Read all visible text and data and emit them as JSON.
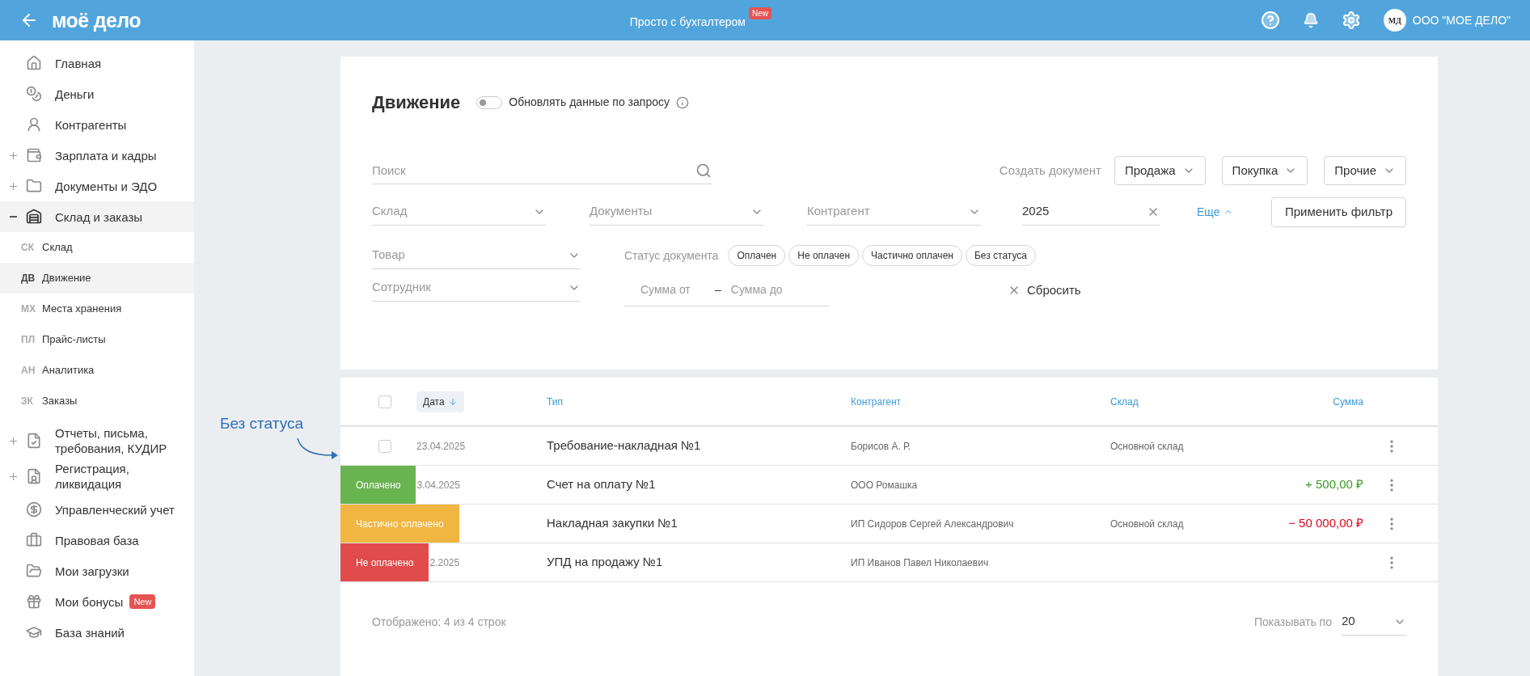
{
  "header": {
    "logo": "моё дело",
    "promo": "Просто с бухгалтером",
    "promo_badge": "New",
    "avatar": "МД",
    "company": "ООО \"МОЕ ДЕЛО\""
  },
  "sidebar": {
    "items": [
      {
        "label": "Главная",
        "selected": false
      },
      {
        "label": "Деньги",
        "selected": false
      },
      {
        "label": "Контрагенты",
        "selected": false
      },
      {
        "label": "Зарплата и кадры",
        "selected": false,
        "expanded": false
      },
      {
        "label": "Документы и ЭДО",
        "selected": false,
        "expanded": false
      },
      {
        "label": "Склад и заказы",
        "selected": true,
        "expanded": true,
        "children": [
          {
            "abbr": "СК",
            "label": "Склад",
            "selected": false
          },
          {
            "abbr": "ДВ",
            "label": "Движение",
            "selected": true
          },
          {
            "abbr": "МХ",
            "label": "Места хранения",
            "selected": false
          },
          {
            "abbr": "ПЛ",
            "label": "Прайс-листы",
            "selected": false
          },
          {
            "abbr": "АН",
            "label": "Аналитика",
            "selected": false
          },
          {
            "abbr": "ЗК",
            "label": "Заказы",
            "selected": false
          }
        ]
      },
      {
        "label": "Отчеты, письма, требования, КУДИР",
        "selected": false,
        "expanded": false
      },
      {
        "label": "Регистрация, ликвидация",
        "selected": false,
        "expanded": false
      },
      {
        "label": "Управленческий учет",
        "selected": false
      },
      {
        "label": "Правовая база",
        "selected": false
      },
      {
        "label": "Мои загрузки",
        "selected": false
      },
      {
        "label": "Мои бонусы",
        "selected": false,
        "badge": "New"
      },
      {
        "label": "База знаний",
        "selected": false
      }
    ]
  },
  "filters": {
    "title": "Движение",
    "auto_update": {
      "label": "Обновлять данные по запросу",
      "on": false
    },
    "search": {
      "placeholder": "Поиск"
    },
    "create_label": "Создать документ",
    "create_buttons": [
      "Продажа",
      "Покупка",
      "Прочие"
    ],
    "selects_row": [
      {
        "placeholder": "Склад"
      },
      {
        "placeholder": "Документы"
      },
      {
        "placeholder": "Контрагент"
      }
    ],
    "year": {
      "value": "2025"
    },
    "more": {
      "label": "Еще",
      "expanded": true
    },
    "apply": "Применить фильтр",
    "product": {
      "placeholder": "Товар"
    },
    "employee": {
      "placeholder": "Сотрудник"
    },
    "status_label": "Статус документа",
    "status_chips": [
      {
        "label": "Оплачен",
        "selected": false
      },
      {
        "label": "Не оплачен",
        "selected": false
      },
      {
        "label": "Частично оплачен",
        "selected": false
      },
      {
        "label": "Без статуса",
        "selected": false
      }
    ],
    "sum_from": {
      "placeholder": "Сумма от"
    },
    "sum_dash": "–",
    "sum_to": {
      "placeholder": "Сумма до"
    },
    "reset": "Сбросить"
  },
  "annotation": "Без статуса",
  "table": {
    "select_all": {
      "checked": false
    },
    "columns": [
      "Дата",
      "Тип",
      "Контрагент",
      "Склад",
      "Сумма"
    ],
    "rows": [
      {
        "checked": false,
        "date": "23.04.2025",
        "type": "Требование-накладная №1",
        "counterparty": "Борисов А. Р.",
        "warehouse": "Основной склад"
      },
      {
        "status": {
          "label": "Оплачено",
          "color": "#6ab351"
        },
        "date": "3.04.2025",
        "type": "Счет на оплату №1",
        "counterparty": "ООО Ромашка",
        "amount": {
          "text": "+ 500,00 ₽",
          "kind": "income"
        }
      },
      {
        "status": {
          "label": "Частично оплачено",
          "color": "#f0b641"
        },
        "type": "Накладная закупки №1",
        "counterparty": "ИП Сидоров Сергей Александрович",
        "warehouse": "Основной склад",
        "amount": {
          "text": "− 50 000,00 ₽",
          "kind": "expense"
        }
      },
      {
        "status": {
          "label": "Не оплачено",
          "color": "#e24b4b"
        },
        "date": "2.2025",
        "type": "УПД на продажу №1",
        "counterparty": "ИП Иванов Павел Николаевич"
      }
    ],
    "footer": "Отображено: 4 из 4 строк",
    "page_size_label": "Показывать по",
    "page_size": "20"
  }
}
